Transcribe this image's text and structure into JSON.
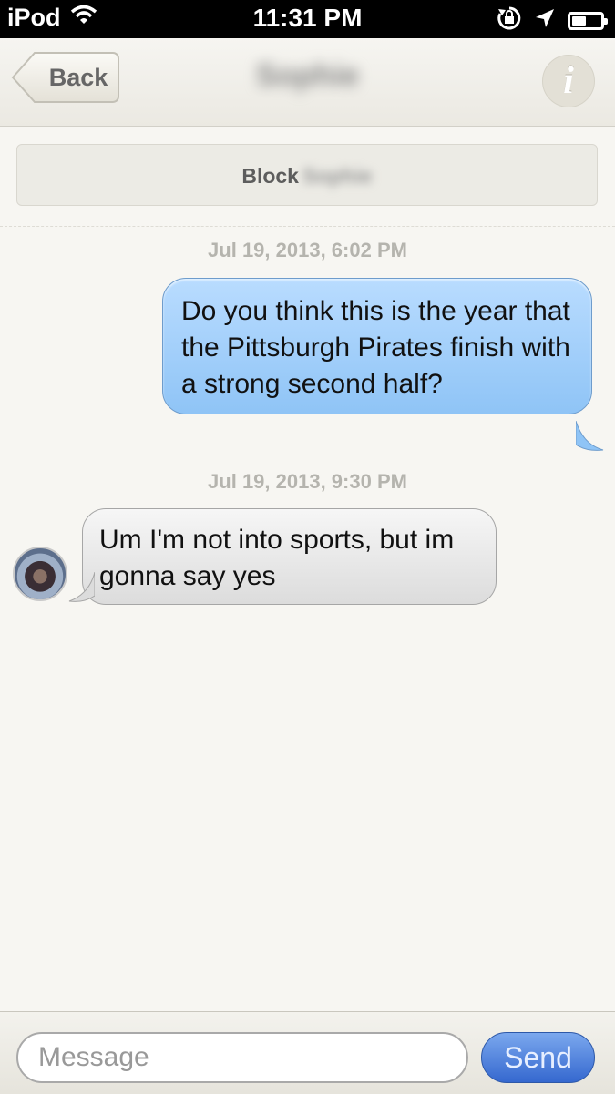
{
  "status_bar": {
    "carrier": "iPod",
    "time": "11:31 PM",
    "icons": [
      "wifi-icon",
      "rotation-lock-icon",
      "location-arrow-icon",
      "battery-icon"
    ],
    "battery_level": 0.5
  },
  "nav": {
    "back_label": "Back",
    "title": "Sophie",
    "info_label": "i"
  },
  "block": {
    "label": "Block",
    "name": "Sophie"
  },
  "messages": [
    {
      "timestamp": "Jul 19, 2013, 6:02 PM",
      "direction": "sent",
      "text": "Do you think this is the year that the Pittsburgh Pirates finish with a strong second half?"
    },
    {
      "timestamp": "Jul 19, 2013, 9:30 PM",
      "direction": "received",
      "text": "Um I'm not into sports, but im gonna say yes"
    }
  ],
  "composer": {
    "placeholder": "Message",
    "send_label": "Send"
  },
  "colors": {
    "sent_bubble": "#9fcdfa",
    "received_bubble": "#e6e6e6",
    "send_button": "#3f72d6"
  }
}
